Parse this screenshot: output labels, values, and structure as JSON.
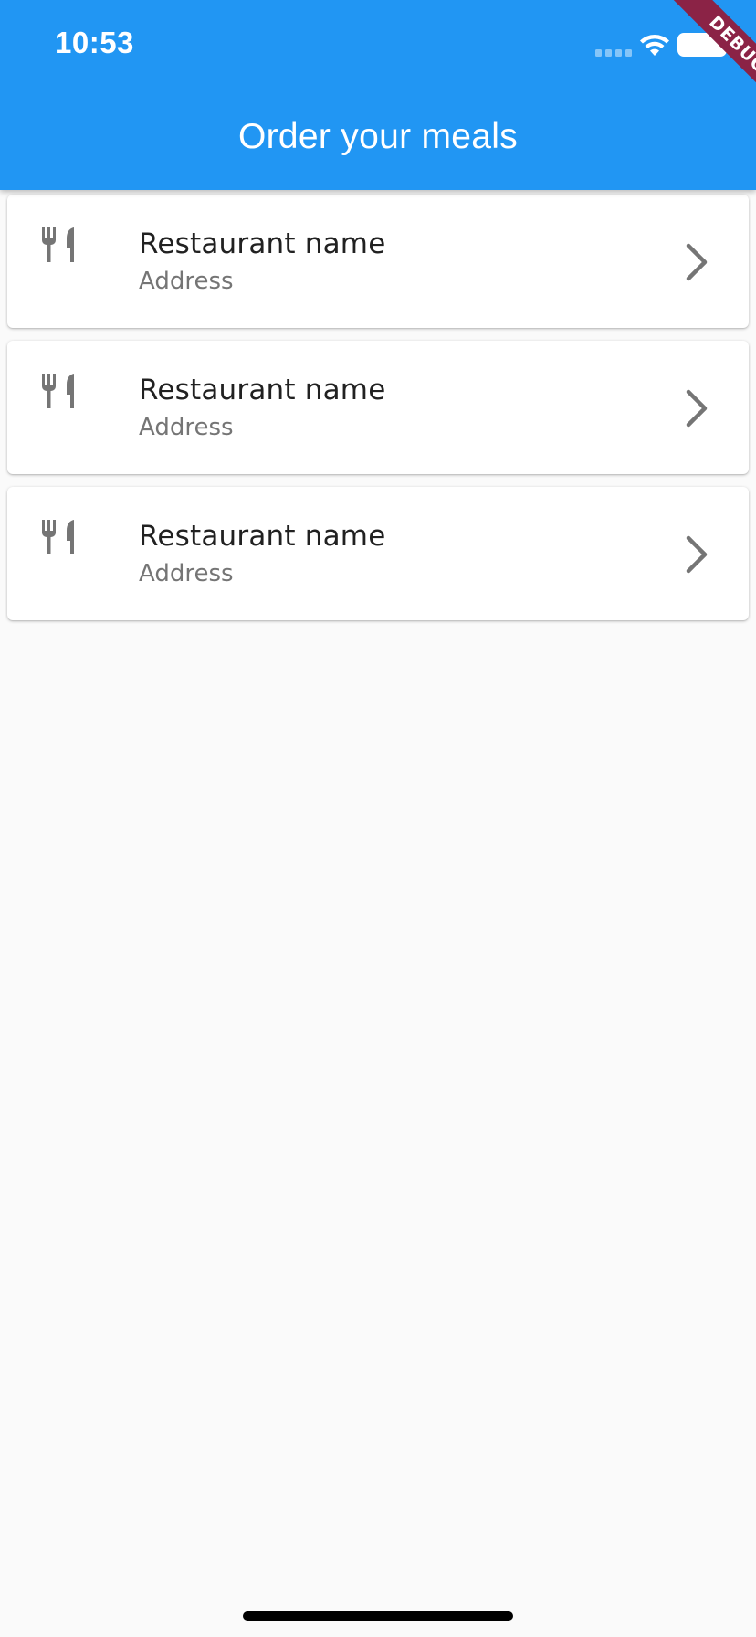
{
  "status_bar": {
    "time": "10:53"
  },
  "debug_banner": {
    "label": "DEBUG"
  },
  "app_bar": {
    "title": "Order your meals"
  },
  "restaurants": [
    {
      "name": "Restaurant name",
      "address": "Address",
      "icon": "restaurant-icon",
      "trailing_icon": "chevron-right-icon"
    },
    {
      "name": "Restaurant name",
      "address": "Address",
      "icon": "restaurant-icon",
      "trailing_icon": "chevron-right-icon"
    },
    {
      "name": "Restaurant name",
      "address": "Address",
      "icon": "restaurant-icon",
      "trailing_icon": "chevron-right-icon"
    }
  ],
  "colors": {
    "primary": "#2196f3",
    "background": "#fafafa",
    "card": "#ffffff",
    "icon": "#757575",
    "title_text": "#212121",
    "subtitle_text": "#757575",
    "debug_ribbon": "#8b2346"
  }
}
